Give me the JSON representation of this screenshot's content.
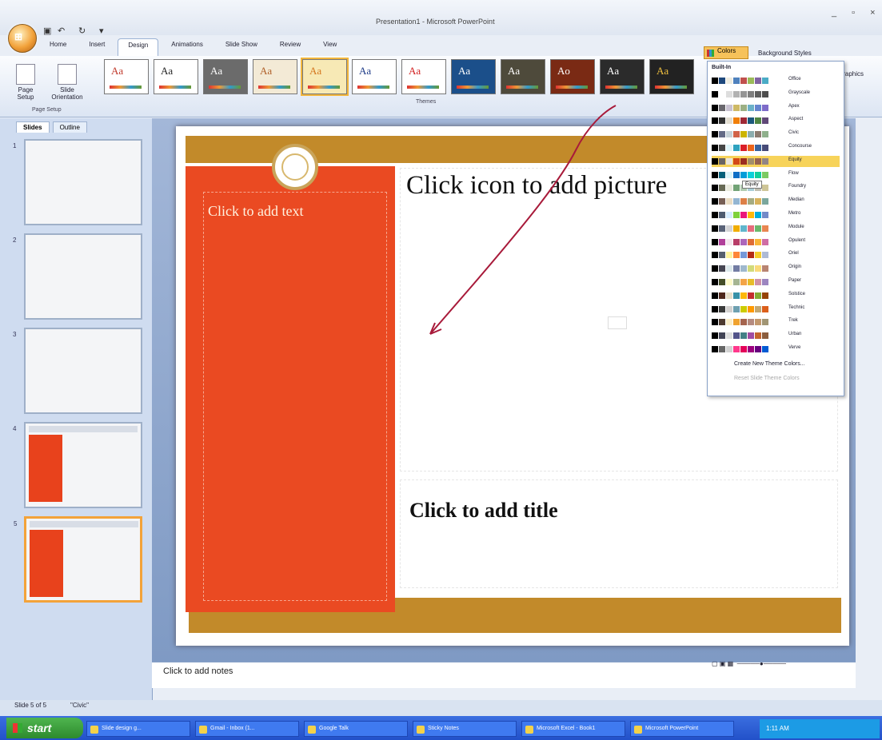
{
  "app": {
    "title": "Presentation1 - Microsoft PowerPoint",
    "tabs": [
      "Home",
      "Insert",
      "Design",
      "Animations",
      "Slide Show",
      "Review",
      "View"
    ],
    "active_tab": "Design",
    "window_controls": "_ ▫ ×"
  },
  "ribbon": {
    "page_setup": "Page Setup",
    "slide_orientation": "Slide Orientation",
    "group_page_setup": "Page Setup",
    "group_themes": "Themes",
    "colors_button": "Colors",
    "background_styles": "Background Styles",
    "graphics": "Graphics",
    "themes": [
      {
        "label": "Aa",
        "bg": "#ffffff",
        "fg": "#c0392b"
      },
      {
        "label": "Aa",
        "bg": "#ffffff",
        "fg": "#222222"
      },
      {
        "label": "Aa",
        "bg": "#6b6b6b",
        "fg": "#ffffff"
      },
      {
        "label": "Aa",
        "bg": "#f3ead6",
        "fg": "#b0602a"
      },
      {
        "label": "Aa",
        "bg": "#f7e9b5",
        "fg": "#d4761e",
        "selected": true
      },
      {
        "label": "Aa",
        "bg": "#ffffff",
        "fg": "#1f3c88"
      },
      {
        "label": "Aa",
        "bg": "#ffffff",
        "fg": "#d22020"
      },
      {
        "label": "Aa",
        "bg": "#1b4f8a",
        "fg": "#ffffff"
      },
      {
        "label": "Aa",
        "bg": "#4e4a3b",
        "fg": "#ffffff"
      },
      {
        "label": "Ao",
        "bg": "#7a2a14",
        "fg": "#ffffff"
      },
      {
        "label": "Aa",
        "bg": "#2b2b2b",
        "fg": "#ffffff"
      },
      {
        "label": "Aa",
        "bg": "#222222",
        "fg": "#f0c040"
      }
    ]
  },
  "left_pane": {
    "tabs": [
      "Slides",
      "Outline"
    ],
    "thumbs": [
      {
        "num": "1",
        "style": "plain"
      },
      {
        "num": "2",
        "style": "plain"
      },
      {
        "num": "3",
        "style": "plain"
      },
      {
        "num": "4",
        "style": "red"
      },
      {
        "num": "5",
        "style": "red",
        "selected": true
      }
    ]
  },
  "slide": {
    "text_placeholder": "Click to add text",
    "picture_placeholder": "Click icon to add picture",
    "title_placeholder": "Click to add title",
    "colors": {
      "band": "#c28a2a",
      "panel": "#ea4a22"
    }
  },
  "notes": {
    "placeholder": "Click to add notes"
  },
  "status": {
    "slide": "Slide 5 of 5",
    "theme": "\"Civic\""
  },
  "colors_menu": {
    "header": "Built-In",
    "tooltip": "Equity",
    "create": "Create New Theme Colors...",
    "reset": "Reset Slide Theme Colors",
    "items": [
      {
        "name": "Office",
        "swatches": [
          "#000000",
          "#1f497d",
          "#eeece1",
          "#4f81bd",
          "#c0504d",
          "#9bbb59",
          "#8064a2",
          "#4bacc6"
        ]
      },
      {
        "name": "Grayscale",
        "swatches": [
          "#000000",
          "#ffffff",
          "#dddddd",
          "#b2b2b2",
          "#969696",
          "#808080",
          "#5f5f5f",
          "#4d4d4d"
        ]
      },
      {
        "name": "Apex",
        "swatches": [
          "#000000",
          "#69676d",
          "#c9c2d1",
          "#ceb966",
          "#9cb084",
          "#6bb1c9",
          "#6585cf",
          "#7e6bc9"
        ]
      },
      {
        "name": "Aspect",
        "swatches": [
          "#000000",
          "#323232",
          "#e3ded1",
          "#f07f09",
          "#9f2936",
          "#1b587c",
          "#4e8542",
          "#604878"
        ]
      },
      {
        "name": "Civic",
        "swatches": [
          "#000000",
          "#646b86",
          "#c5d1d7",
          "#d16349",
          "#ccb400",
          "#8cadae",
          "#8c7b70",
          "#8fb08c"
        ]
      },
      {
        "name": "Concourse",
        "swatches": [
          "#000000",
          "#464646",
          "#def5fa",
          "#2da2bf",
          "#da1f28",
          "#eb641b",
          "#39639d",
          "#474b78"
        ]
      },
      {
        "name": "Equity",
        "swatches": [
          "#000000",
          "#696464",
          "#e9e5dc",
          "#d34817",
          "#9b2d1f",
          "#a28e6a",
          "#956251",
          "#918485"
        ],
        "highlight": true
      },
      {
        "name": "Flow",
        "swatches": [
          "#000000",
          "#04617b",
          "#dbf5f9",
          "#0f6fc6",
          "#009dd9",
          "#0bd0d9",
          "#10cf9b",
          "#7cca62"
        ]
      },
      {
        "name": "Foundry",
        "swatches": [
          "#000000",
          "#676a55",
          "#eaebde",
          "#72a376",
          "#b0ccb0",
          "#a8cdd7",
          "#c0beaf",
          "#cec597"
        ]
      },
      {
        "name": "Median",
        "swatches": [
          "#000000",
          "#775f55",
          "#ebddc3",
          "#94b6d2",
          "#dd8047",
          "#a5ab81",
          "#d8b25c",
          "#7ba79d"
        ]
      },
      {
        "name": "Metro",
        "swatches": [
          "#000000",
          "#4e5b6f",
          "#d6ecff",
          "#7fd13b",
          "#ea157a",
          "#feb80a",
          "#00addc",
          "#738ac8"
        ]
      },
      {
        "name": "Module",
        "swatches": [
          "#000000",
          "#5a6378",
          "#d4d4d6",
          "#f0ad00",
          "#60b5cc",
          "#e66c7d",
          "#6bb76d",
          "#e88651"
        ]
      },
      {
        "name": "Opulent",
        "swatches": [
          "#000000",
          "#b13f9a",
          "#f4e7ed",
          "#b83d68",
          "#ac66bb",
          "#de6c36",
          "#f9b639",
          "#cf6da4"
        ]
      },
      {
        "name": "Oriel",
        "swatches": [
          "#000000",
          "#575f6d",
          "#fff39d",
          "#fe8637",
          "#7598d9",
          "#b32c16",
          "#f5cd2d",
          "#aebad5"
        ]
      },
      {
        "name": "Origin",
        "swatches": [
          "#000000",
          "#464653",
          "#dde9ec",
          "#727ca3",
          "#9fb8cd",
          "#d2da7a",
          "#fada7a",
          "#b88472"
        ]
      },
      {
        "name": "Paper",
        "swatches": [
          "#000000",
          "#444d26",
          "#fefac9",
          "#a5b592",
          "#f3a447",
          "#e7bc29",
          "#d092a7",
          "#9c85c0"
        ]
      },
      {
        "name": "Solstice",
        "swatches": [
          "#000000",
          "#4f271c",
          "#e7dec9",
          "#3891a7",
          "#feb80a",
          "#c32d2e",
          "#84aa33",
          "#964305"
        ]
      },
      {
        "name": "Technic",
        "swatches": [
          "#000000",
          "#3b3b3b",
          "#d4d2d0",
          "#6ea0b0",
          "#cccc00",
          "#ff9900",
          "#c2a874",
          "#db5f1b"
        ]
      },
      {
        "name": "Trek",
        "swatches": [
          "#000000",
          "#4e3b30",
          "#fbeec9",
          "#f0a22e",
          "#a5644e",
          "#b58b80",
          "#c3986d",
          "#a19574"
        ]
      },
      {
        "name": "Urban",
        "swatches": [
          "#000000",
          "#424456",
          "#dedede",
          "#53548a",
          "#438086",
          "#a04da3",
          "#c4652d",
          "#8b5d3d"
        ]
      },
      {
        "name": "Verve",
        "swatches": [
          "#000000",
          "#666666",
          "#d2d2d2",
          "#ff388c",
          "#e40059",
          "#9c007f",
          "#68007f",
          "#005bd3"
        ]
      }
    ]
  },
  "taskbar": {
    "start": "start",
    "tasks": [
      "Slide design g...",
      "Gmail - Inbox (1...",
      "Google Talk",
      "Sticky Notes",
      "Microsoft Excel - Book1",
      "Microsoft PowerPoint"
    ],
    "clock": "1:11 AM"
  }
}
